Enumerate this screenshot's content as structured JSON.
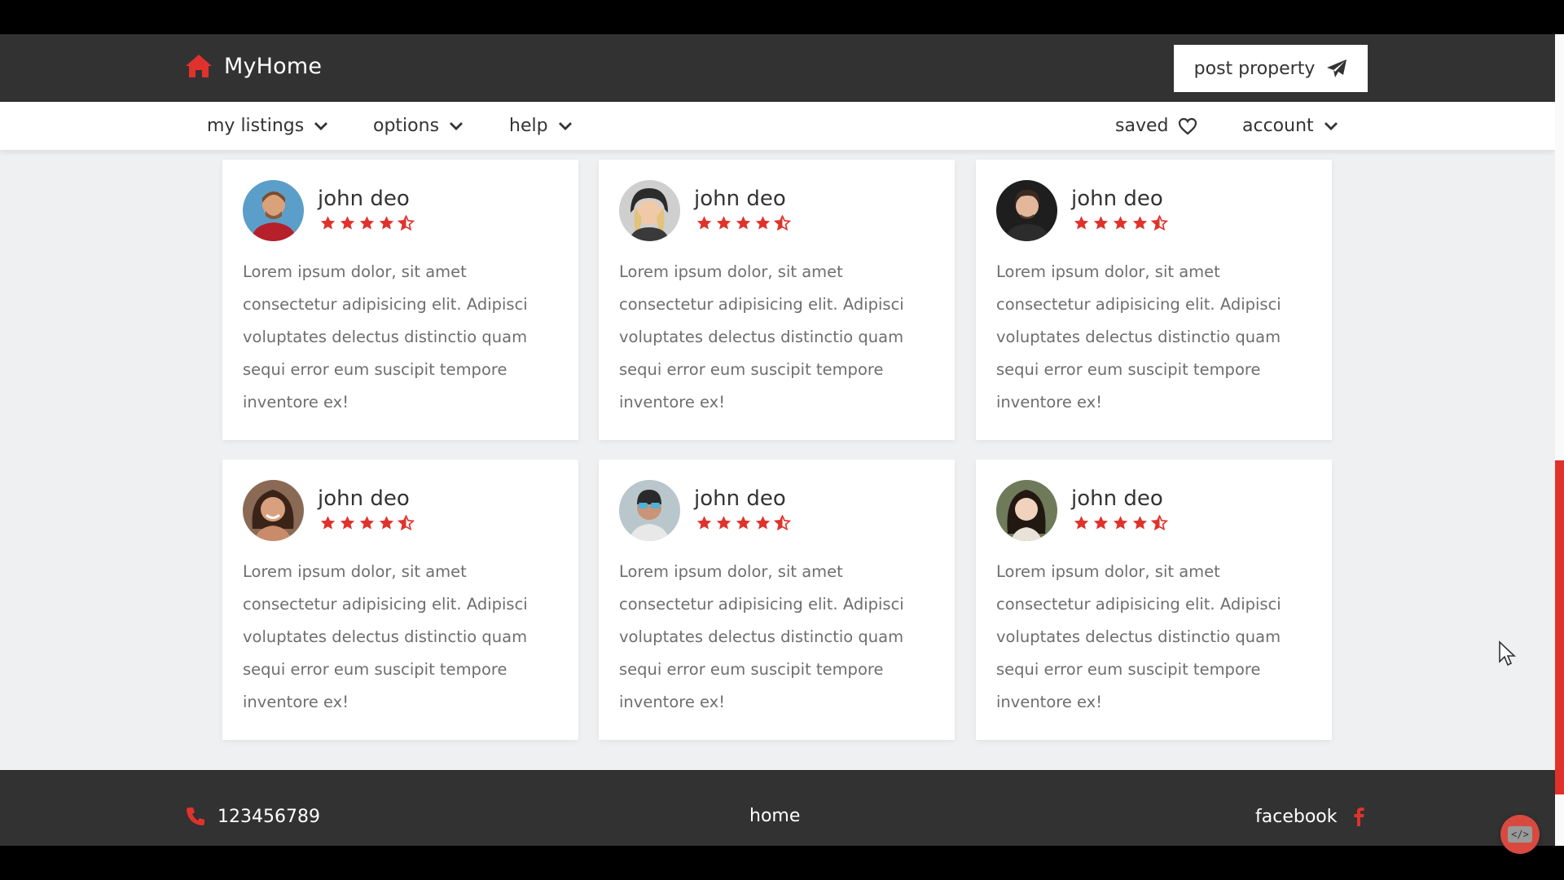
{
  "header": {
    "logo_text": "MyHome",
    "post_button": "post property",
    "colors": {
      "accent": "#e0322c",
      "dark": "#323232"
    }
  },
  "nav": {
    "left_items": [
      {
        "label": "my listings",
        "icon": "chevron-down-icon"
      },
      {
        "label": "options",
        "icon": "chevron-down-icon"
      },
      {
        "label": "help",
        "icon": "chevron-down-icon"
      }
    ],
    "saved": {
      "label": "saved",
      "icon": "heart-icon"
    },
    "account": {
      "label": "account",
      "icon": "chevron-down-icon"
    }
  },
  "reviews": [
    {
      "name": "john deo",
      "rating": 4.5,
      "text": "Lorem ipsum dolor, sit amet consectetur adipisicing elit. Adipisci voluptates delectus distinctio quam sequi error eum suscipit tempore inventore ex!"
    },
    {
      "name": "john deo",
      "rating": 4.5,
      "text": "Lorem ipsum dolor, sit amet consectetur adipisicing elit. Adipisci voluptates delectus distinctio quam sequi error eum suscipit tempore inventore ex!"
    },
    {
      "name": "john deo",
      "rating": 4.5,
      "text": "Lorem ipsum dolor, sit amet consectetur adipisicing elit. Adipisci voluptates delectus distinctio quam sequi error eum suscipit tempore inventore ex!"
    },
    {
      "name": "john deo",
      "rating": 4.5,
      "text": "Lorem ipsum dolor, sit amet consectetur adipisicing elit. Adipisci voluptates delectus distinctio quam sequi error eum suscipit tempore inventore ex!"
    },
    {
      "name": "john deo",
      "rating": 4.5,
      "text": "Lorem ipsum dolor, sit amet consectetur adipisicing elit. Adipisci voluptates delectus distinctio quam sequi error eum suscipit tempore inventore ex!"
    },
    {
      "name": "john deo",
      "rating": 4.5,
      "text": "Lorem ipsum dolor, sit amet consectetur adipisicing elit. Adipisci voluptates delectus distinctio quam sequi error eum suscipit tempore inventore ex!"
    }
  ],
  "footer": {
    "phone": "123456789",
    "home": "home",
    "facebook": "facebook"
  },
  "dev_button_label": "</>"
}
